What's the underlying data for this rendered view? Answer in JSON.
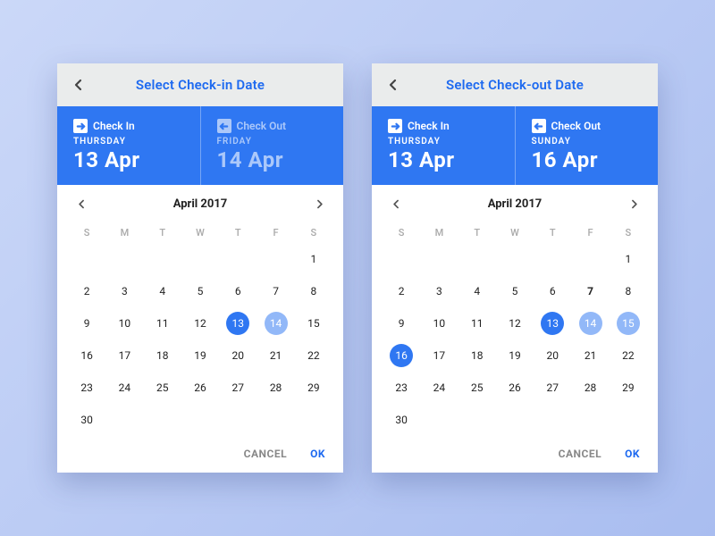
{
  "dow": [
    "S",
    "M",
    "T",
    "W",
    "T",
    "F",
    "S"
  ],
  "actions": {
    "cancel": "CANCEL",
    "ok": "OK"
  },
  "screens": [
    {
      "title": "Select Check-in Date",
      "month": "April 2017",
      "checkin": {
        "label": "Check In",
        "day": "THURSDAY",
        "date": "13 Apr",
        "dim": false
      },
      "checkout": {
        "label": "Check Out",
        "day": "FRIDAY",
        "date": "14 Apr",
        "dim": true
      },
      "startOffset": 6,
      "daysInMonth": 30,
      "marks": {
        "13": "primary",
        "14": "range"
      },
      "bold": []
    },
    {
      "title": "Select Check-out Date",
      "month": "April 2017",
      "checkin": {
        "label": "Check In",
        "day": "THURSDAY",
        "date": "13 Apr",
        "dim": false
      },
      "checkout": {
        "label": "Check Out",
        "day": "SUNDAY",
        "date": "16 Apr",
        "dim": false
      },
      "startOffset": 6,
      "daysInMonth": 30,
      "marks": {
        "13": "primary",
        "14": "range",
        "15": "range",
        "16": "primary"
      },
      "bold": [
        "7"
      ]
    }
  ]
}
